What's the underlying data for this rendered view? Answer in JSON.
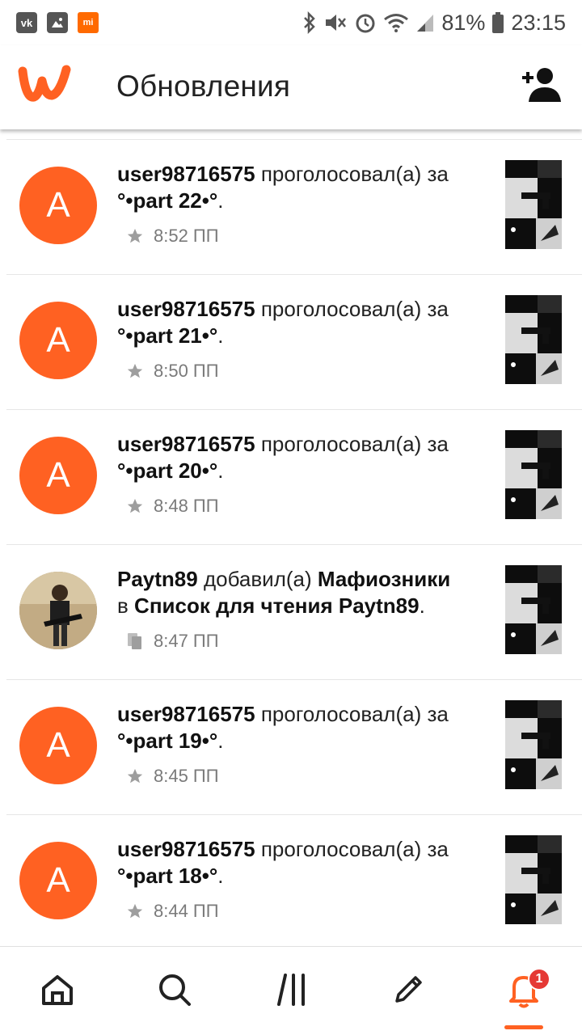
{
  "statusbar": {
    "battery": "81%",
    "time": "23:15",
    "vk_label": "vk",
    "mi_label": "mi"
  },
  "header": {
    "title": "Обновления"
  },
  "colors": {
    "accent": "#ff6122",
    "badge": "#e53935"
  },
  "feed": [
    {
      "user": "user98716575",
      "action": "проголосовал(а) за",
      "target": "°•part 22•°",
      "suffix": ".",
      "time": "8:52 ПП",
      "avatar_letter": "A",
      "icon": "star-icon"
    },
    {
      "user": "user98716575",
      "action": "проголосовал(а) за",
      "target": "°•part 21•°",
      "suffix": ".",
      "time": "8:50 ПП",
      "avatar_letter": "A",
      "icon": "star-icon"
    },
    {
      "user": "user98716575",
      "action": "проголосовал(а) за",
      "target": "°•part 20•°",
      "suffix": ".",
      "time": "8:48 ПП",
      "avatar_letter": "A",
      "icon": "star-icon"
    },
    {
      "user": "Paytn89",
      "action": "добавил(а)",
      "target": "Мафиозники",
      "connector": "в",
      "list": "Список для чтения Paytn89",
      "suffix": ".",
      "time": "8:47 ПП",
      "icon": "reading-list-icon"
    },
    {
      "user": "user98716575",
      "action": "проголосовал(а) за",
      "target": "°•part 19•°",
      "suffix": ".",
      "time": "8:45 ПП",
      "avatar_letter": "A",
      "icon": "star-icon"
    },
    {
      "user": "user98716575",
      "action": "проголосовал(а) за",
      "target": "°•part 18•°",
      "suffix": ".",
      "time": "8:44 ПП",
      "avatar_letter": "A",
      "icon": "star-icon"
    }
  ],
  "nav": {
    "notifications_badge": "1"
  }
}
